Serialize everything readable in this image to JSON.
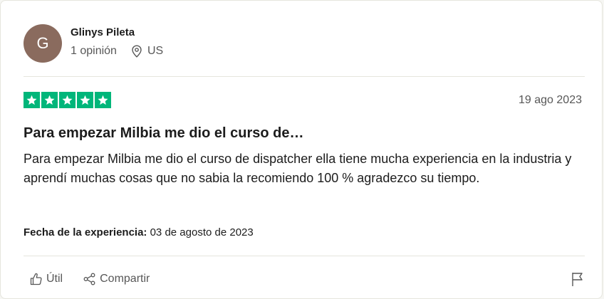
{
  "reviewer": {
    "initial": "G",
    "name": "Glinys Pileta",
    "reviews_count": "1 opinión",
    "country": "US",
    "avatar_color": "#8a6b5e"
  },
  "review": {
    "rating": 5,
    "max_rating": 5,
    "star_color": "#00b67a",
    "date": "19 ago 2023",
    "title": "Para empezar Milbia me dio el curso de…",
    "body": "Para empezar Milbia me dio el curso de dispatcher ella tiene mucha experiencia en la industria y aprendí muchas cosas que no sabia la recomiendo 100 % agradezco su tiempo.",
    "experience_label": "Fecha de la experiencia:",
    "experience_date": "03 de agosto de 2023"
  },
  "actions": {
    "useful_label": "Útil",
    "share_label": "Compartir",
    "useful_icon": "thumbs-up-icon",
    "share_icon": "share-icon",
    "report_icon": "flag-icon"
  }
}
